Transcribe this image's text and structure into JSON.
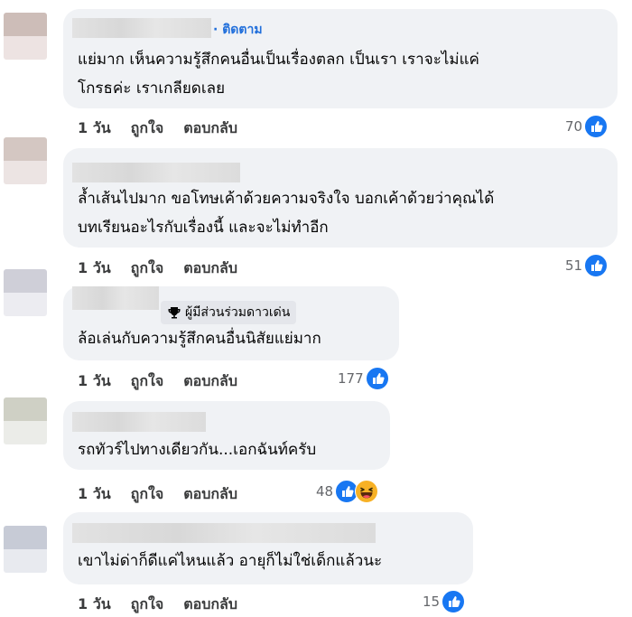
{
  "comments": [
    {
      "follow_label": "· ติดตาม",
      "badge_label": "",
      "text_lines": [
        "แย่มาก เห็นความรู้สึกคนอื่นเป็นเรื่องตลก เป็นเรา เราจะไม่แค่",
        "โกรธค่ะ เราเกลียดเลย"
      ],
      "time": "1 วัน",
      "like_label": "ถูกใจ",
      "reply_label": "ตอบกลับ",
      "reaction_count": "70",
      "reactions": [
        "like-icon"
      ]
    },
    {
      "follow_label": "",
      "badge_label": "",
      "text_lines": [
        "ล้ำเส้นไปมาก ขอโทษเค้าด้วยความจริงใจ บอกเค้าด้วยว่าคุณได้",
        "บทเรียนอะไรกับเรื่องนี้ และจะไม่ทำอีก"
      ],
      "time": "1 วัน",
      "like_label": "ถูกใจ",
      "reply_label": "ตอบกลับ",
      "reaction_count": "51",
      "reactions": [
        "like-icon"
      ]
    },
    {
      "follow_label": "",
      "badge_label": "ผู้มีส่วนร่วมดาวเด่น",
      "text_lines": [
        "ล้อเล่นกับความรู้สึกคนอื่นนิสัยแย่มาก"
      ],
      "time": "1 วัน",
      "like_label": "ถูกใจ",
      "reply_label": "ตอบกลับ",
      "reaction_count": "177",
      "reactions": [
        "like-icon"
      ]
    },
    {
      "follow_label": "",
      "badge_label": "",
      "text_lines": [
        "รถทัวร์ไปทางเดียวกัน...เอกฉันท์ครับ"
      ],
      "time": "1 วัน",
      "like_label": "ถูกใจ",
      "reply_label": "ตอบกลับ",
      "reaction_count": "48",
      "reactions": [
        "like-icon",
        "haha-icon"
      ]
    },
    {
      "follow_label": "",
      "badge_label": "",
      "text_lines": [
        "เขาไม่ด่าก็ดีแค่ไหนแล้ว อายุก็ไม่ใช่เด็กแล้วนะ"
      ],
      "time": "1 วัน",
      "like_label": "ถูกใจ",
      "reply_label": "ตอบกลับ",
      "reaction_count": "15",
      "reactions": [
        "like-icon"
      ]
    }
  ],
  "colors": {
    "bubble": "#f0f2f5",
    "like_blue": "#1877f2",
    "follow_blue": "#216fdb"
  }
}
